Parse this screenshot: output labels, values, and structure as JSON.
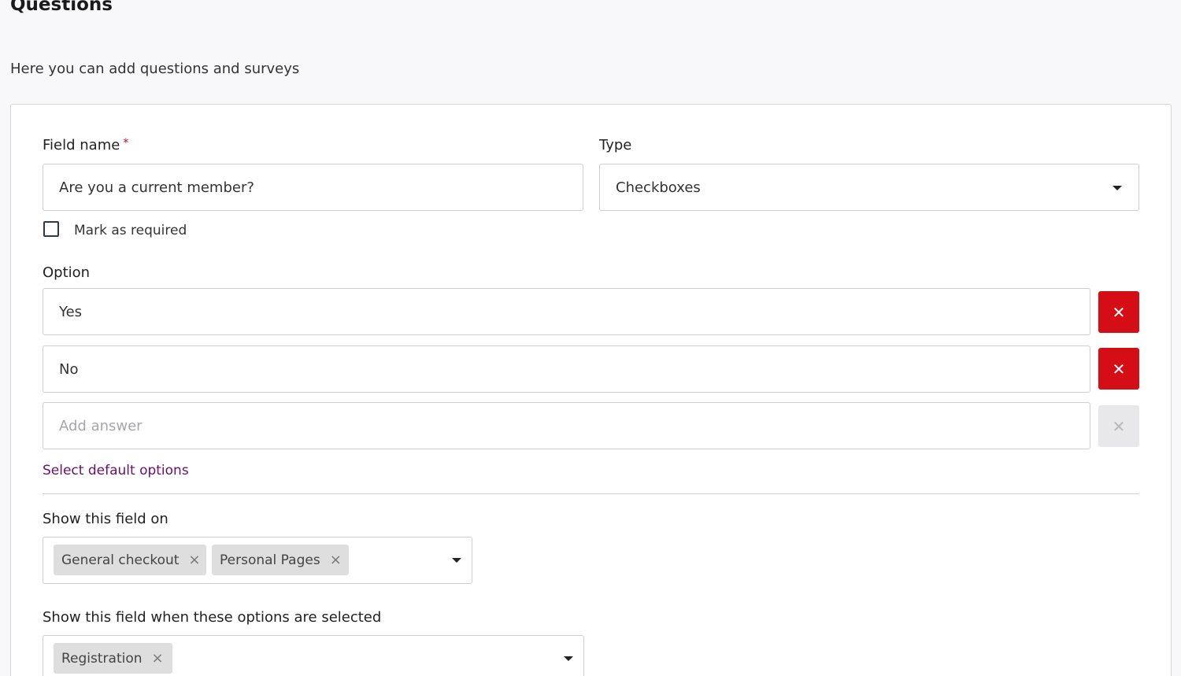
{
  "page": {
    "title": "Questions",
    "subtitle": "Here you can add questions and surveys"
  },
  "field_name": {
    "label": "Field name",
    "required_mark": "*",
    "value": "Are you a current member?"
  },
  "type": {
    "label": "Type",
    "selected": "Checkboxes"
  },
  "mark_required": {
    "label": "Mark as required",
    "checked": false
  },
  "options": {
    "label": "Option",
    "items": [
      {
        "value": "Yes",
        "delete_icon": "close-icon"
      },
      {
        "value": "No",
        "delete_icon": "close-icon"
      }
    ],
    "add_placeholder": "Add answer",
    "default_link": "Select default options"
  },
  "show_on": {
    "label": "Show this field on",
    "tags": [
      "General checkout",
      "Personal Pages"
    ],
    "remove_glyph": "×"
  },
  "show_when": {
    "label": "Show this field when these options are selected",
    "tags": [
      "Registration"
    ]
  },
  "icons": {
    "close": "✕",
    "caret": "chevron-down-icon"
  },
  "colors": {
    "delete_button": "#d50e16",
    "link": "#6a0f6e",
    "required_star": "#d0021b"
  }
}
